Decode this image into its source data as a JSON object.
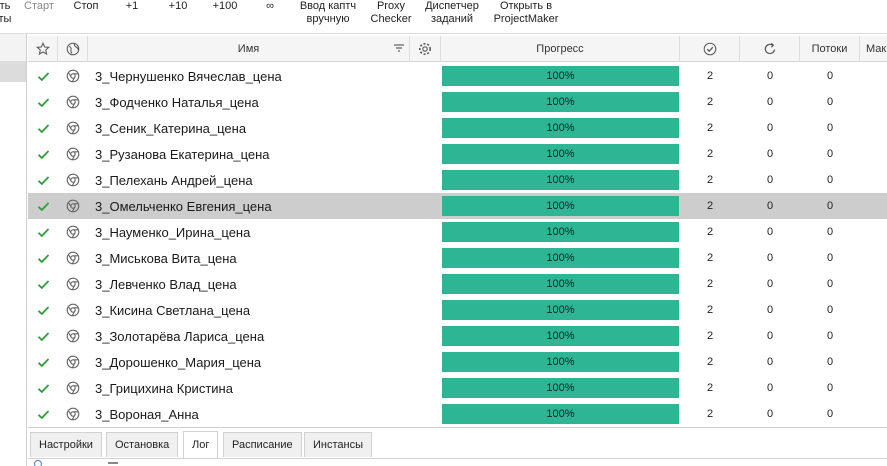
{
  "toolbar": {
    "items": [
      {
        "line1": "ть",
        "line2": "ты",
        "disabled": false
      },
      {
        "line1": "Старт",
        "line2": "",
        "disabled": true
      },
      {
        "line1": "Стоп",
        "line2": "",
        "disabled": false
      },
      {
        "line1": "+1",
        "line2": "",
        "disabled": false
      },
      {
        "line1": "+10",
        "line2": "",
        "disabled": false
      },
      {
        "line1": "+100",
        "line2": "",
        "disabled": false
      },
      {
        "line1": "∞",
        "line2": "",
        "disabled": false
      },
      {
        "line1": "Ввод каптч",
        "line2": "вручную",
        "disabled": false
      },
      {
        "line1": "Proxy",
        "line2": "Checker",
        "disabled": false
      },
      {
        "line1": "Диспетчер",
        "line2": "заданий",
        "disabled": false
      },
      {
        "line1": "Открыть в",
        "line2": "ProjectMaker",
        "disabled": false
      }
    ]
  },
  "grid": {
    "columns": {
      "favorite_icon": "star-icon",
      "browser_icon": "globe-icon",
      "name": "Имя",
      "filter_icon": "filter-icon",
      "settings_icon": "gear-icon",
      "progress": "Прогресс",
      "done_icon": "check-circle-icon",
      "fail_icon": "refresh-icon",
      "threads": "Потоки",
      "max": "Мак"
    },
    "rows": [
      {
        "name": "3_Чернушенко Вячеслав_цена",
        "progress": 100,
        "progress_label": "100%",
        "done": "2",
        "fail": "0",
        "threads": "0",
        "selected": false
      },
      {
        "name": "3_Фодченко Наталья_цена",
        "progress": 100,
        "progress_label": "100%",
        "done": "2",
        "fail": "0",
        "threads": "0",
        "selected": false
      },
      {
        "name": "3_Сеник_Катерина_цена",
        "progress": 100,
        "progress_label": "100%",
        "done": "2",
        "fail": "0",
        "threads": "0",
        "selected": false
      },
      {
        "name": "3_Рузанова Екатерина_цена",
        "progress": 100,
        "progress_label": "100%",
        "done": "2",
        "fail": "0",
        "threads": "0",
        "selected": false
      },
      {
        "name": "3_Пелехань Андрей_цена",
        "progress": 100,
        "progress_label": "100%",
        "done": "2",
        "fail": "0",
        "threads": "0",
        "selected": false
      },
      {
        "name": "3_Омельченко Евгения_цена",
        "progress": 100,
        "progress_label": "100%",
        "done": "2",
        "fail": "0",
        "threads": "0",
        "selected": true
      },
      {
        "name": "3_Науменко_Ирина_цена",
        "progress": 100,
        "progress_label": "100%",
        "done": "2",
        "fail": "0",
        "threads": "0",
        "selected": false
      },
      {
        "name": "3_Миськова Вита_цена",
        "progress": 100,
        "progress_label": "100%",
        "done": "2",
        "fail": "0",
        "threads": "0",
        "selected": false
      },
      {
        "name": "3_Левченко Влад_цена",
        "progress": 100,
        "progress_label": "100%",
        "done": "2",
        "fail": "0",
        "threads": "0",
        "selected": false
      },
      {
        "name": "3_Кисина Светлана_цена",
        "progress": 100,
        "progress_label": "100%",
        "done": "2",
        "fail": "0",
        "threads": "0",
        "selected": false
      },
      {
        "name": "3_Золотарёва Лариса_цена",
        "progress": 100,
        "progress_label": "100%",
        "done": "2",
        "fail": "0",
        "threads": "0",
        "selected": false
      },
      {
        "name": "3_Дорошенко_Мария_цена",
        "progress": 100,
        "progress_label": "100%",
        "done": "2",
        "fail": "0",
        "threads": "0",
        "selected": false
      },
      {
        "name": "3_Грицихина Кристина",
        "progress": 100,
        "progress_label": "100%",
        "done": "2",
        "fail": "0",
        "threads": "0",
        "selected": false
      },
      {
        "name": "3_Вороная_Анна",
        "progress": 100,
        "progress_label": "100%",
        "done": "2",
        "fail": "0",
        "threads": "0",
        "selected": false
      }
    ],
    "row_icons": {
      "status": "check-icon",
      "browser": "chrome-icon"
    }
  },
  "tabs": {
    "items": [
      {
        "label": "Настройки",
        "active": false
      },
      {
        "label": "Остановка",
        "active": false
      },
      {
        "label": "Лог",
        "active": true
      },
      {
        "label": "Расписание",
        "active": false
      },
      {
        "label": "Инстансы",
        "active": false
      }
    ]
  },
  "colors": {
    "progress_fill": "#2db594",
    "check_green": "#2e9e3a",
    "selected_row": "#cdcdcd"
  }
}
